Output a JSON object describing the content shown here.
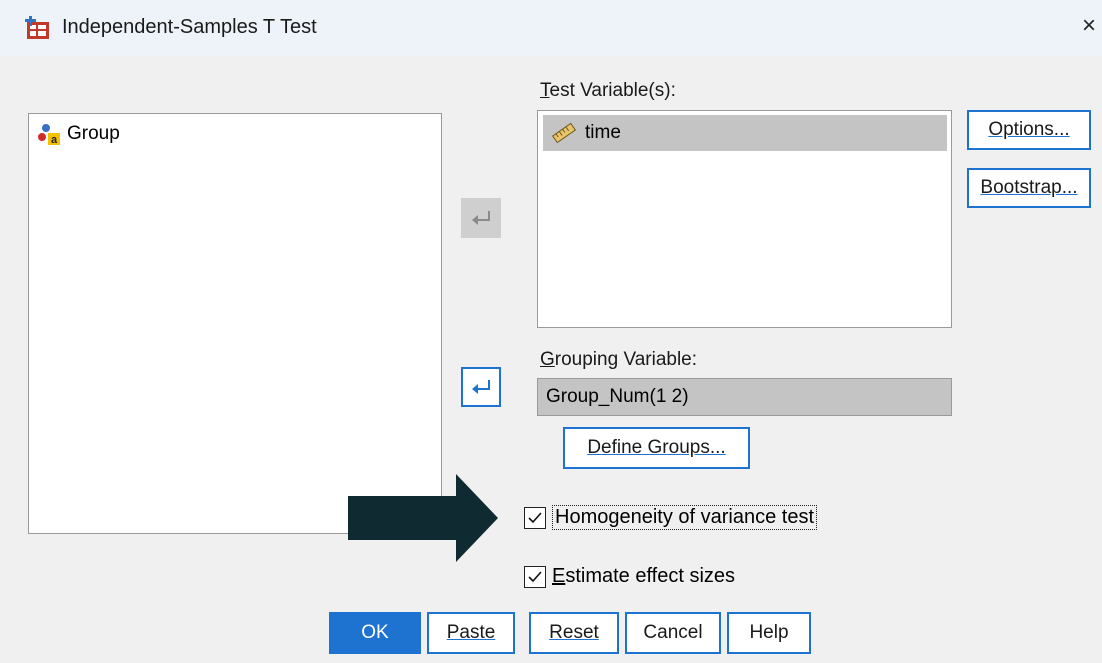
{
  "window": {
    "title": "Independent-Samples T Test",
    "close": "×"
  },
  "source_list": {
    "items": [
      {
        "label": "Group",
        "icon": "nominal-string-variable-icon"
      }
    ]
  },
  "test_variables": {
    "label_prefix": "T",
    "label_rest": "est Variable(s):",
    "items": [
      {
        "label": "time",
        "icon": "scale-ruler-icon"
      }
    ]
  },
  "grouping_variable": {
    "label_prefix": "G",
    "label_rest": "rouping Variable:",
    "value": "Group_Num(1 2)"
  },
  "buttons": {
    "options": "Options...",
    "bootstrap": "Bootstrap...",
    "define_groups": "Define Groups...",
    "ok": "OK",
    "paste": "Paste",
    "reset": "Reset",
    "cancel": "Cancel",
    "help": "Help"
  },
  "checkboxes": {
    "homogeneity": {
      "label": "Homogeneity of variance test",
      "checked": true
    },
    "effect_sizes": {
      "label_prefix": "E",
      "label_rest": "stimate effect sizes",
      "checked": true
    }
  },
  "colors": {
    "accent": "#1e73d0",
    "selection": "#c4c4c4",
    "annotation_arrow": "#0f2a30"
  }
}
